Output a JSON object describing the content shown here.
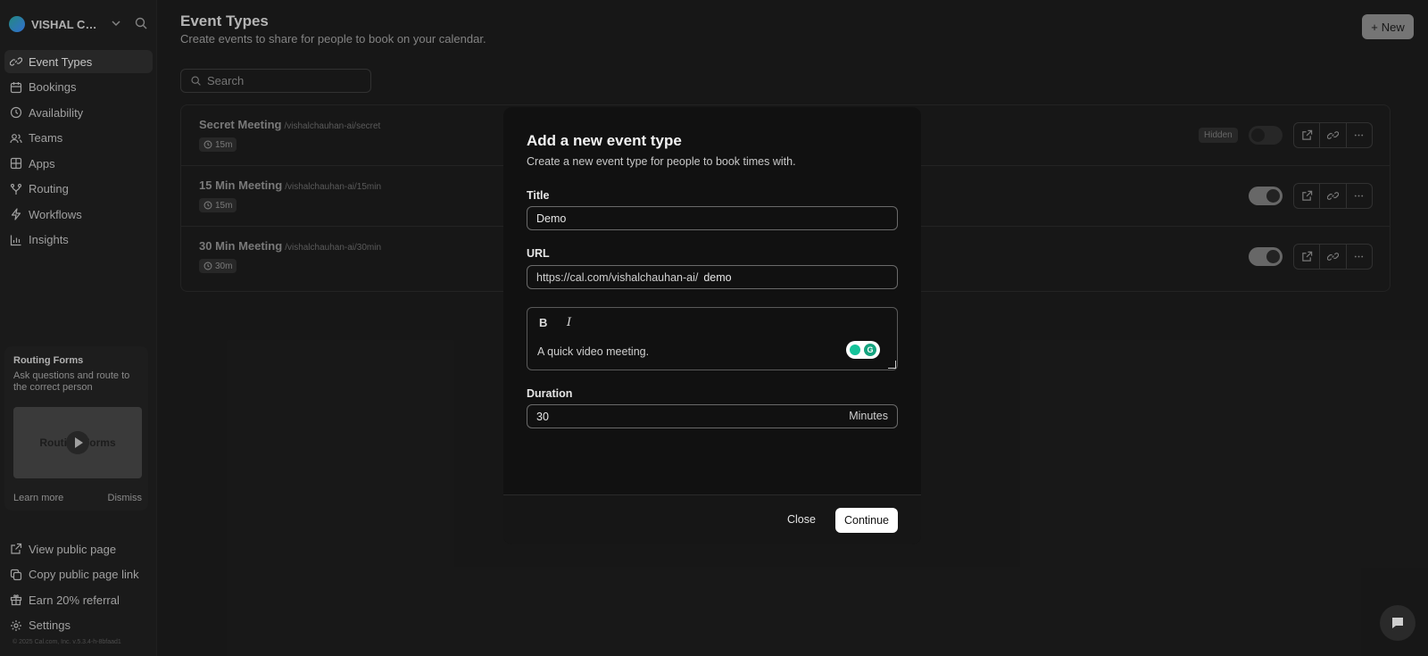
{
  "sidebar": {
    "user_name": "VISHAL CH...",
    "nav": [
      {
        "label": "Event Types",
        "icon": "link-icon"
      },
      {
        "label": "Bookings",
        "icon": "calendar-icon"
      },
      {
        "label": "Availability",
        "icon": "clock-icon"
      },
      {
        "label": "Teams",
        "icon": "users-icon"
      },
      {
        "label": "Apps",
        "icon": "grid-icon"
      },
      {
        "label": "Routing",
        "icon": "split-icon"
      },
      {
        "label": "Workflows",
        "icon": "zap-icon"
      },
      {
        "label": "Insights",
        "icon": "chart-icon"
      }
    ],
    "promo": {
      "title": "Routing Forms",
      "description": "Ask questions and route to the correct person",
      "thumb_text": "Routing Forms",
      "learn_more": "Learn more",
      "dismiss": "Dismiss"
    },
    "bottom_nav": [
      {
        "label": "View public page",
        "icon": "external-link-icon"
      },
      {
        "label": "Copy public page link",
        "icon": "copy-icon"
      },
      {
        "label": "Earn 20% referral",
        "icon": "gift-icon"
      },
      {
        "label": "Settings",
        "icon": "gear-icon"
      }
    ],
    "copyright": "© 2025 Cal.com, Inc. v.5.3.4-h-8bfaad1"
  },
  "header": {
    "title": "Event Types",
    "subtitle": "Create events to share for people to book on your calendar.",
    "new_button": "New"
  },
  "search": {
    "placeholder": "Search"
  },
  "events": [
    {
      "title": "Secret Meeting",
      "slug": "/vishalchauhan-ai/secret",
      "duration": "15m",
      "hidden_label": "Hidden",
      "enabled": false
    },
    {
      "title": "15 Min Meeting",
      "slug": "/vishalchauhan-ai/15min",
      "duration": "15m",
      "hidden_label": "",
      "enabled": true
    },
    {
      "title": "30 Min Meeting",
      "slug": "/vishalchauhan-ai/30min",
      "duration": "30m",
      "hidden_label": "",
      "enabled": true
    }
  ],
  "modal": {
    "title": "Add a new event type",
    "subtitle": "Create a new event type for people to book times with.",
    "title_label": "Title",
    "title_value": "Demo",
    "url_label": "URL",
    "url_prefix": "https://cal.com/vishalchauhan-ai/",
    "url_value": "demo",
    "bold_label": "B",
    "italic_label": "I",
    "description_value": "A quick video meeting.",
    "duration_label": "Duration",
    "duration_value": "30",
    "duration_unit": "Minutes",
    "close_label": "Close",
    "continue_label": "Continue"
  }
}
